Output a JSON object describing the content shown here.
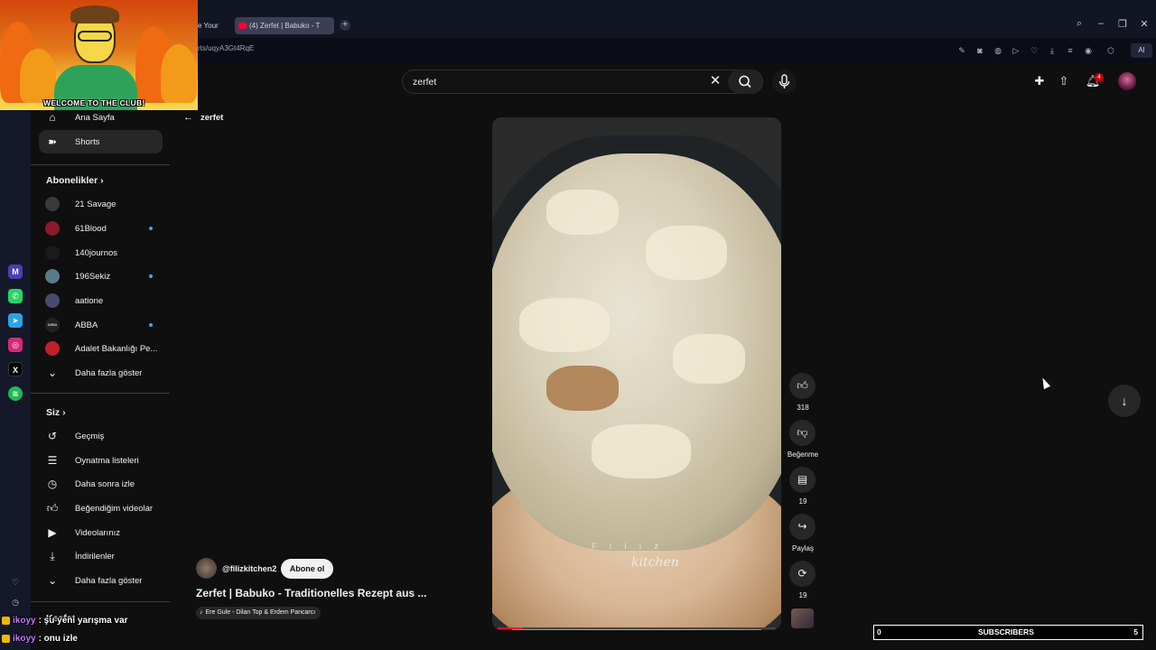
{
  "browser": {
    "tab1_title": "e Your Day",
    "tab2_title": "(4) Zerfet | Babuko - T",
    "url": "rts/uqyA3Gt4RqE",
    "ai_label": "AI"
  },
  "overlay": {
    "welcome_text": "WELCOME TO THE CLUB!"
  },
  "search": {
    "value": "zerfet"
  },
  "header": {
    "notification_count": "4"
  },
  "sidebar": {
    "main": [
      {
        "label": "Ana Sayfa"
      },
      {
        "label": "Shorts"
      }
    ],
    "subscriptions_title": "Abonelikler",
    "subscriptions": [
      {
        "label": "21 Savage",
        "new": false,
        "color": "#3a3a3a"
      },
      {
        "label": "61Blood",
        "new": true,
        "color": "#8a1a2a"
      },
      {
        "label": "140journos",
        "new": false,
        "color": "#1a1a1a"
      },
      {
        "label": "196Sekiz",
        "new": true,
        "color": "#5a7a8a"
      },
      {
        "label": "aatione",
        "new": false,
        "color": "#4a4a6a"
      },
      {
        "label": "ABBA",
        "new": true,
        "color": "#222222"
      },
      {
        "label": "Adalet Bakanlığı Pe...",
        "new": false,
        "color": "#c0202a"
      }
    ],
    "show_more": "Daha fazla göster",
    "you_title": "Siz",
    "you_items": [
      {
        "label": "Geçmiş"
      },
      {
        "label": "Oynatma listeleri"
      },
      {
        "label": "Daha sonra izle"
      },
      {
        "label": "Beğendiğim videolar"
      },
      {
        "label": "Videolarınız"
      },
      {
        "label": "İndirilenler"
      }
    ],
    "show_more_2": "Daha fazla göster",
    "explore_title": "Keşfet"
  },
  "short": {
    "back_label": "zerfet",
    "channel_handle": "@filizkitchen2",
    "subscribe_label": "Abone ol",
    "title": "Zerfet | Babuko - Traditionelles Rezept aus ...",
    "music": "Ere Gule - Dilan Top & Erdem Pancarcı",
    "watermark_top": "F i l i z",
    "watermark_bottom": "kitchen",
    "progress": 0.09,
    "actions": {
      "likes": "318",
      "dislike_label": "Beğenme",
      "comments": "19",
      "share_label": "Paylaş",
      "remix": "19"
    }
  },
  "stream": {
    "chat": [
      {
        "user": "ikoyy",
        "message": ": şu yeni yarışma var"
      },
      {
        "user": "ikoyy",
        "message": ": onu izle"
      }
    ],
    "sub_counter": {
      "left": "0",
      "label": "SUBSCRIBERS",
      "right": "5"
    }
  }
}
